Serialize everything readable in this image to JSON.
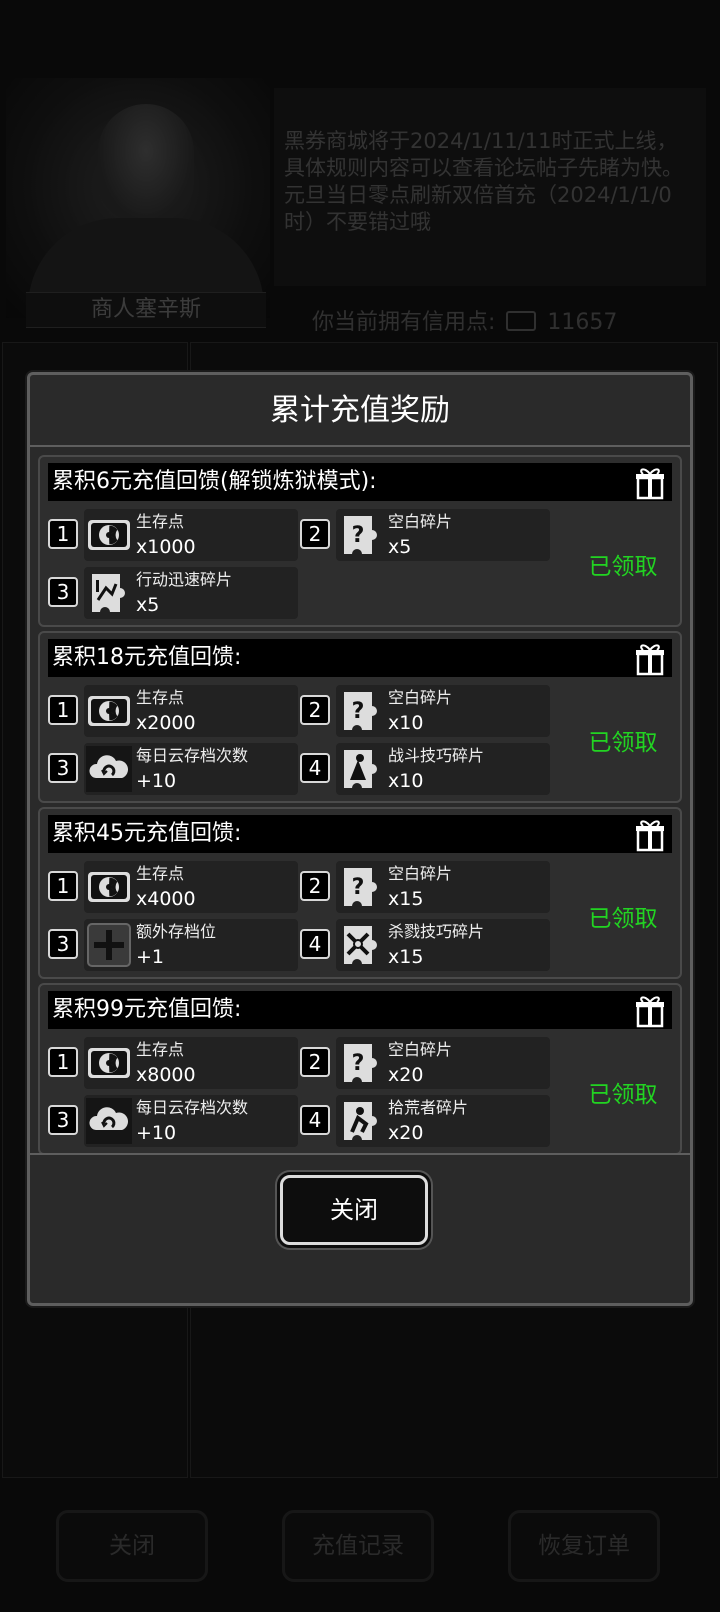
{
  "background": {
    "merchant_name": "商人塞辛斯",
    "notice_text": "黑券商城将于2024/1/11/11时正式上线，具体规则内容可以查看论坛帖子先睹为快。元旦当日零点刷新双倍首充（2024/1/1/0时）不要错过哦",
    "credit_label": "你当前拥有信用点:",
    "credit_value": "11657",
    "buttons": [
      "关闭",
      "充值记录",
      "恢复订单"
    ]
  },
  "modal": {
    "title": "累计充值奖励",
    "close_label": "关闭",
    "claimed_label": "已领取",
    "tiers": [
      {
        "title": "累积6元充值回馈(解锁炼狱模式):",
        "rewards": [
          {
            "index": "1",
            "icon": "radiation-icon",
            "name": "生存点",
            "qty": "x1000"
          },
          {
            "index": "2",
            "icon": "blank-puzzle-icon",
            "name": "空白碎片",
            "qty": "x5"
          },
          {
            "index": "3",
            "icon": "speed-puzzle-icon",
            "name": "行动迅速碎片",
            "qty": "x5"
          }
        ]
      },
      {
        "title": "累积18元充值回馈:",
        "rewards": [
          {
            "index": "1",
            "icon": "radiation-icon",
            "name": "生存点",
            "qty": "x2000"
          },
          {
            "index": "2",
            "icon": "blank-puzzle-icon",
            "name": "空白碎片",
            "qty": "x10"
          },
          {
            "index": "3",
            "icon": "cloud-save-icon",
            "name": "每日云存档次数",
            "qty": "+10"
          },
          {
            "index": "4",
            "icon": "combat-puzzle-icon",
            "name": "战斗技巧碎片",
            "qty": "x10"
          }
        ]
      },
      {
        "title": "累积45元充值回馈:",
        "rewards": [
          {
            "index": "1",
            "icon": "radiation-icon",
            "name": "生存点",
            "qty": "x4000"
          },
          {
            "index": "2",
            "icon": "blank-puzzle-icon",
            "name": "空白碎片",
            "qty": "x15"
          },
          {
            "index": "3",
            "icon": "extra-slot-icon",
            "name": "额外存档位",
            "qty": "+1"
          },
          {
            "index": "4",
            "icon": "slaughter-puzzle-icon",
            "name": "杀戮技巧碎片",
            "qty": "x15"
          }
        ]
      },
      {
        "title": "累积99元充值回馈:",
        "rewards": [
          {
            "index": "1",
            "icon": "radiation-icon",
            "name": "生存点",
            "qty": "x8000"
          },
          {
            "index": "2",
            "icon": "blank-puzzle-icon",
            "name": "空白碎片",
            "qty": "x20"
          },
          {
            "index": "3",
            "icon": "cloud-save-icon",
            "name": "每日云存档次数",
            "qty": "+10"
          },
          {
            "index": "4",
            "icon": "scavenger-puzzle-icon",
            "name": "拾荒者碎片",
            "qty": "x20"
          }
        ]
      }
    ]
  },
  "colors": {
    "claimed": "#22d422",
    "panel": "#2a2a2a",
    "border": "#5e5e5e"
  }
}
